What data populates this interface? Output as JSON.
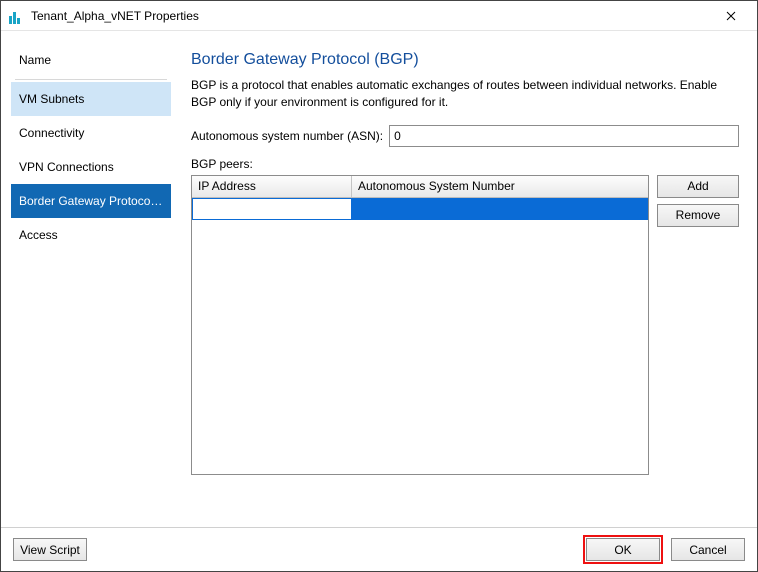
{
  "window": {
    "title": "Tenant_Alpha_vNET Properties"
  },
  "sidebar": {
    "header": "Name",
    "items": [
      {
        "label": "VM Subnets"
      },
      {
        "label": "Connectivity"
      },
      {
        "label": "VPN Connections"
      },
      {
        "label": "Border Gateway Protocol..."
      },
      {
        "label": "Access"
      }
    ]
  },
  "main": {
    "heading": "Border Gateway Protocol (BGP)",
    "description": "BGP is a protocol that enables automatic exchanges of routes between individual networks. Enable BGP only if your environment is configured for it.",
    "asn_label": "Autonomous system number (ASN):",
    "asn_value": "0",
    "peers_label": "BGP peers:",
    "grid": {
      "col_ip": "IP Address",
      "col_asn": "Autonomous System Number",
      "rows": [
        {
          "ip": "",
          "asn": ""
        }
      ]
    },
    "buttons": {
      "add": "Add",
      "remove": "Remove"
    }
  },
  "footer": {
    "view_script": "View Script",
    "ok": "OK",
    "cancel": "Cancel"
  }
}
